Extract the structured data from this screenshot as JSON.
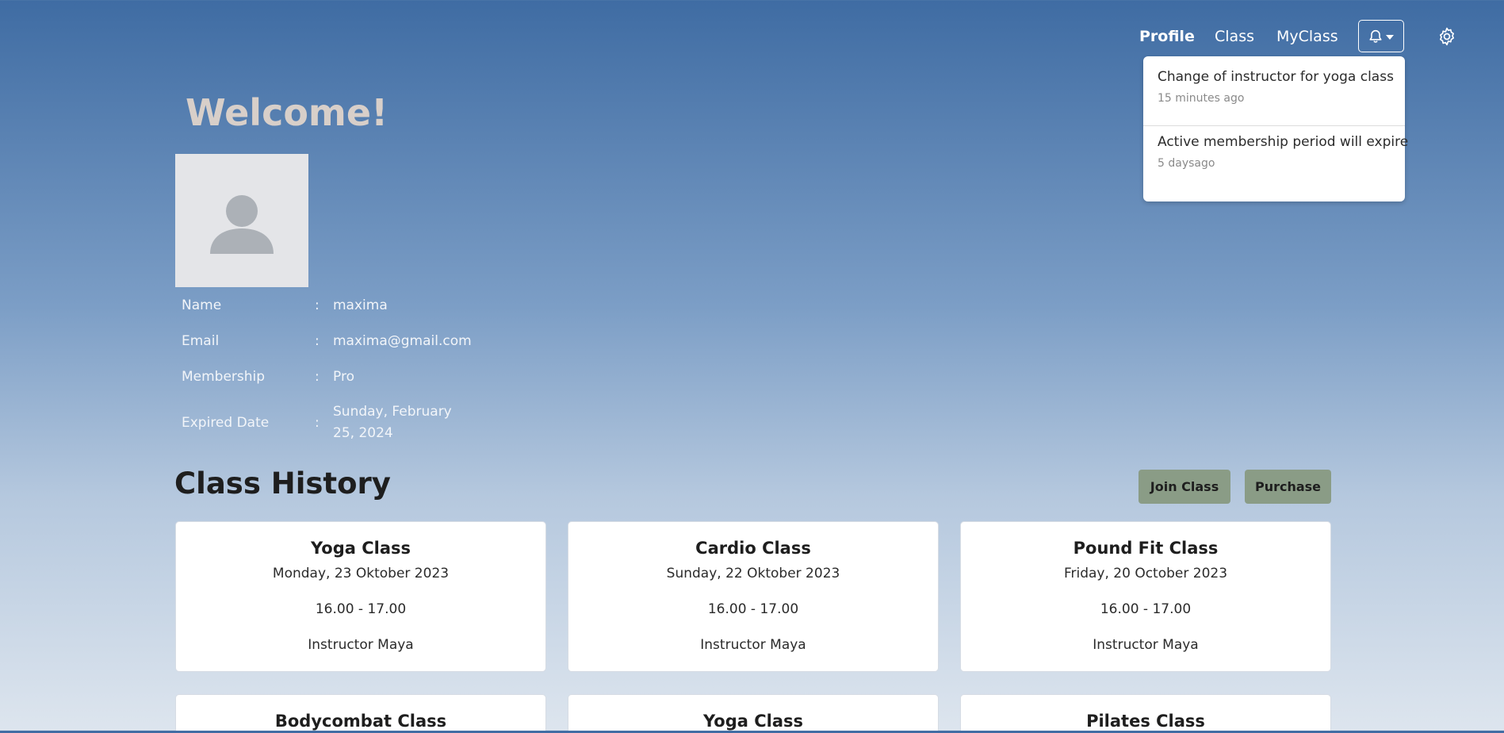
{
  "nav": {
    "profile": "Profile",
    "class": "Class",
    "myclass": "MyClass",
    "bell_icon": "bell-icon",
    "settings_icon": "gear-icon"
  },
  "notifications": [
    {
      "title": "Change of instructor for yoga class",
      "time": "15 minutes ago"
    },
    {
      "title": "Active membership period will expire",
      "time": "5 daysago"
    }
  ],
  "profile": {
    "welcome": "Welcome!",
    "avatar_icon": "user-placeholder-icon",
    "fields": [
      {
        "label": "Name",
        "value": "maxima"
      },
      {
        "label": "Email",
        "value": "maxima@gmail.com"
      },
      {
        "label": "Membership",
        "value": "Pro"
      },
      {
        "label": "Expired Date",
        "value": "Sunday, February 25, 2024"
      }
    ],
    "separator": ":"
  },
  "history": {
    "title": "Class History",
    "join_label": "Join Class",
    "purchase_label": "Purchase",
    "cards": [
      {
        "title": "Yoga Class",
        "date": "Monday, 23 Oktober 2023",
        "time": "16.00 - 17.00",
        "instructor": "Instructor Maya"
      },
      {
        "title": "Cardio Class",
        "date": "Sunday, 22 Oktober 2023",
        "time": "16.00 - 17.00",
        "instructor": "Instructor Maya"
      },
      {
        "title": "Pound Fit Class",
        "date": "Friday, 20 October 2023",
        "time": "16.00 - 17.00",
        "instructor": "Instructor Maya"
      },
      {
        "title": "Bodycombat Class"
      },
      {
        "title": "Yoga Class"
      },
      {
        "title": "Pilates Class"
      }
    ]
  },
  "colors": {
    "gradient_top": "#3f6ca3",
    "gradient_bottom": "#dde5ee",
    "button_bg": "#8a9c86",
    "welcome_text": "#d8cfc9"
  }
}
